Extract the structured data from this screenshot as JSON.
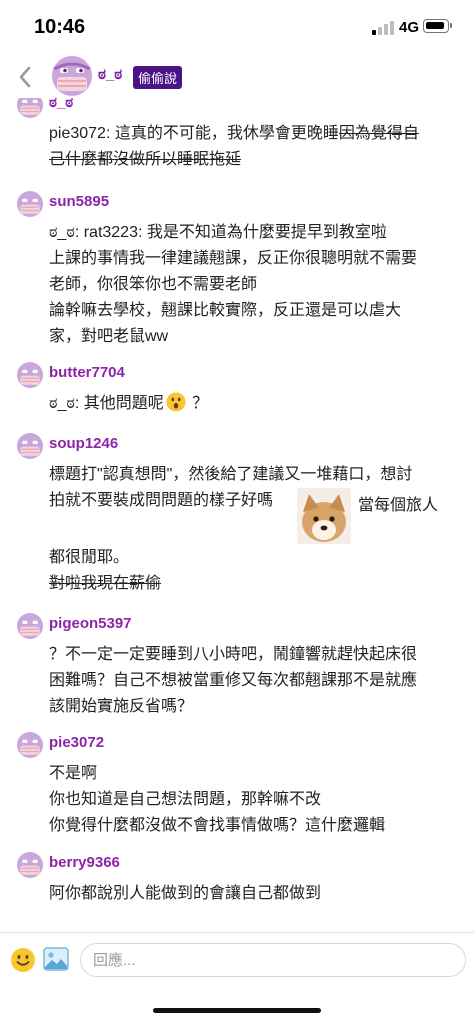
{
  "status_bar": {
    "time": "10:46",
    "network": "4G"
  },
  "header": {
    "username": "ಠ_ಠ",
    "badge": "偷偷說"
  },
  "messages": [
    {
      "name": "ಠ_ಠ",
      "lines": [
        "pie3072: 這真的不可能，我休學會更晚睡",
        "己什麼都沒做所以睡眠拖延"
      ],
      "strike_tail": "因為覺得自"
    },
    {
      "name": "sun5895",
      "lines": [
        "ಠ_ಠ: rat3223: 我是不知道為什麼要提早到教室啦",
        "上課的事情我一律建議翹課，反正你很聰明就不需要",
        "老師，你很笨你也不需要老師",
        "論幹嘛去學校，翹課比較實際，反正還是可以虐大",
        "家，對吧老鼠ww"
      ]
    },
    {
      "name": "butter7704",
      "prefix": "ಠ_ಠ: 其他問題呢",
      "suffix": "？"
    },
    {
      "name": "soup1246",
      "lines": [
        "標題打\"認真想問\"，然後給了建議又一堆藉口，想討",
        "拍就不要裝成問問題的樣子好嗎",
        "都很閒耶。",
        "對啦我現在薪偷"
      ],
      "image_caption": "當每個旅人"
    },
    {
      "name": "pigeon5397",
      "lines": [
        "？不一定一定要睡到八小時吧，鬧鐘響就趕快起床很",
        "困難嗎？自己不想被當重修又每次都翹課那不是就應",
        "該開始實施反省嗎？"
      ]
    },
    {
      "name": "pie3072",
      "lines": [
        "不是啊",
        "你也知道是自己想法問題，那幹嘛不改",
        "你覺得什麼都沒做不會找事情做嗎？這什麼邏輯"
      ]
    },
    {
      "name": "berry9366",
      "lines": [
        "阿你都說別人能做到的會讓自己都做到"
      ]
    }
  ],
  "reply": {
    "placeholder": "回應..."
  },
  "colors": {
    "accent": "#8e24aa",
    "badge_bg": "#4a1486",
    "avatar_bg": "#c9a6dc",
    "avatar_stripe": "#e7a9b8"
  }
}
